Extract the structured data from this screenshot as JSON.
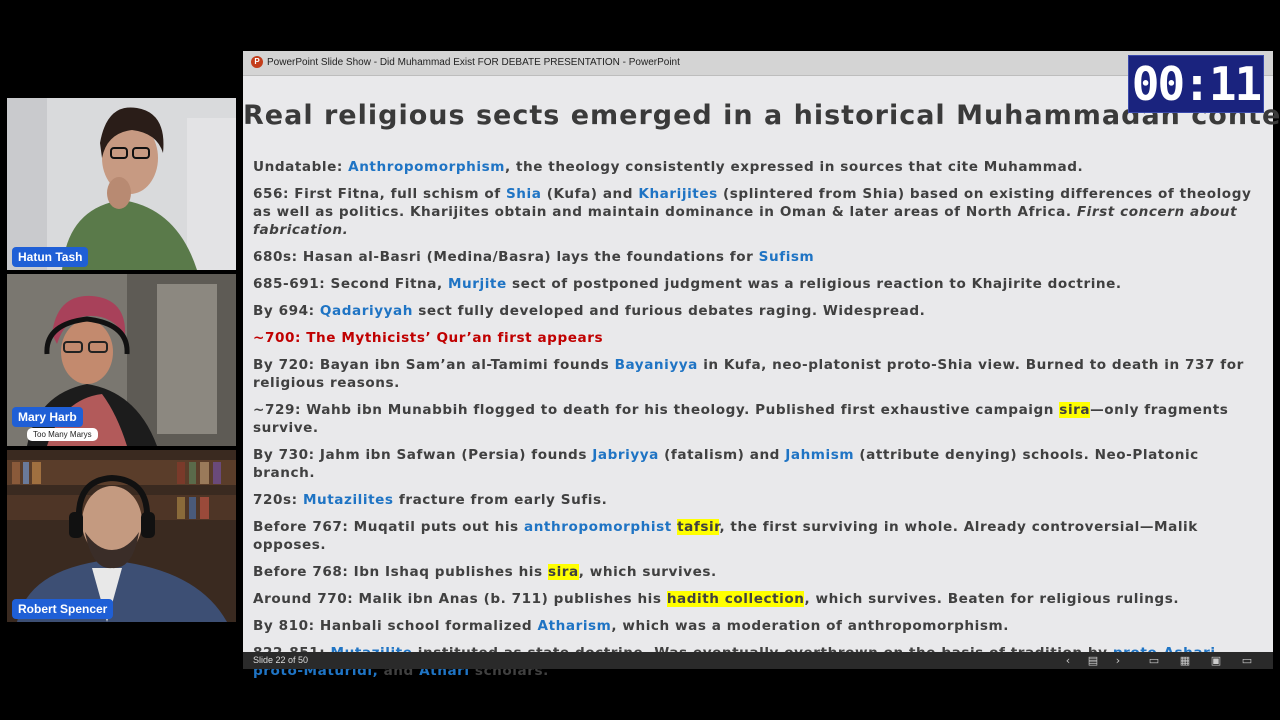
{
  "participants": [
    {
      "name": "Hatun Tash"
    },
    {
      "name": "Mary Harb",
      "subtitle": "Too Many Marys"
    },
    {
      "name": "Robert Spencer"
    }
  ],
  "window": {
    "title": "PowerPoint Slide Show  -  Did Muhammad Exist FOR DEBATE PRESENTATION - PowerPoint"
  },
  "timer": {
    "text": "00:11"
  },
  "slide": {
    "title": "Real religious sects emerged in a historical Muhammadan context",
    "paragraphs": [
      [
        {
          "t": "Undatable: "
        },
        {
          "t": "Anthropomorphism",
          "c": "bl"
        },
        {
          "t": ", the theology consistently expressed in sources that cite Muhammad."
        }
      ],
      [
        {
          "t": "656: First Fitna, full schism of "
        },
        {
          "t": "Shia",
          "c": "bl"
        },
        {
          "t": " (Kufa) and "
        },
        {
          "t": "Kharijites",
          "c": "bl"
        },
        {
          "t": " (splintered from Shia) based on existing differences of theology as well as politics. Kharijites obtain and maintain dominance in Oman & later areas of North Africa. "
        },
        {
          "t": "First concern about fabrication.",
          "c": "it"
        }
      ],
      [
        {
          "t": "680s: Hasan al-Basri (Medina/Basra) lays the foundations for "
        },
        {
          "t": "Sufism",
          "c": "bl"
        }
      ],
      [
        {
          "t": "685-691: Second Fitna, "
        },
        {
          "t": "Murjite",
          "c": "bl"
        },
        {
          "t": " sect of postponed judgment was a religious reaction to Khajirite doctrine."
        }
      ],
      [
        {
          "t": "By 694: "
        },
        {
          "t": "Qadariyyah",
          "c": "bl"
        },
        {
          "t": " sect fully developed and furious debates raging. Widespread."
        }
      ],
      [
        {
          "t": "~700: The Mythicists’ Qur’an first appears",
          "c": "red"
        }
      ],
      [
        {
          "t": "By 720: Bayan ibn Sam’an al-Tamimi founds "
        },
        {
          "t": "Bayaniyya",
          "c": "bl"
        },
        {
          "t": " in Kufa, neo-platonist proto-Shia view. Burned to death in 737 for religious reasons."
        }
      ],
      [
        {
          "t": "~729: Wahb ibn Munabbih flogged to death for his theology. Published first exhaustive campaign "
        },
        {
          "t": "sira",
          "c": "hl"
        },
        {
          "t": "—only fragments survive."
        }
      ],
      [
        {
          "t": "By 730: Jahm ibn Safwan (Persia) founds "
        },
        {
          "t": "Jabriyya",
          "c": "bl"
        },
        {
          "t": " (fatalism) and "
        },
        {
          "t": "Jahmism",
          "c": "bl"
        },
        {
          "t": " (attribute denying) schools. Neo-Platonic branch."
        }
      ],
      [
        {
          "t": "720s: "
        },
        {
          "t": "Mutazilites",
          "c": "bl"
        },
        {
          "t": " fracture from early Sufis."
        }
      ],
      [
        {
          "t": "Before 767: Muqatil puts out his "
        },
        {
          "t": "anthropomorphist",
          "c": "bl"
        },
        {
          "t": " "
        },
        {
          "t": "tafsir",
          "c": "hl"
        },
        {
          "t": ", the first surviving in whole. Already controversial—Malik opposes."
        }
      ],
      [
        {
          "t": "Before 768: Ibn Ishaq publishes his "
        },
        {
          "t": "sira",
          "c": "hl"
        },
        {
          "t": ", which survives."
        }
      ],
      [
        {
          "t": "Around 770: Malik ibn Anas (b. 711) publishes his "
        },
        {
          "t": "hadith collection",
          "c": "hl"
        },
        {
          "t": ", which survives. Beaten for religious rulings."
        }
      ],
      [
        {
          "t": "By 810: Hanbali school formalized "
        },
        {
          "t": "Atharism",
          "c": "bl"
        },
        {
          "t": ", which was a moderation of anthropomorphism."
        }
      ],
      [
        {
          "t": "822-851: "
        },
        {
          "t": "Mutazilite",
          "c": "bl"
        },
        {
          "t": " instituted as state doctrine. Was eventually overthrown on the basis of tradition by "
        },
        {
          "t": "proto-Ashari, proto-Maturidi,",
          "c": "bl"
        },
        {
          "t": " and "
        },
        {
          "t": "Athari",
          "c": "bl"
        },
        {
          "t": " scholars."
        }
      ]
    ]
  },
  "status": {
    "slide_counter": "Slide 22 of 50",
    "icons": [
      "chevron-left-icon",
      "slide-menu-icon",
      "chevron-right-icon",
      "normal-view-icon",
      "slide-sorter-icon",
      "reading-view-icon",
      "slideshow-icon"
    ]
  }
}
